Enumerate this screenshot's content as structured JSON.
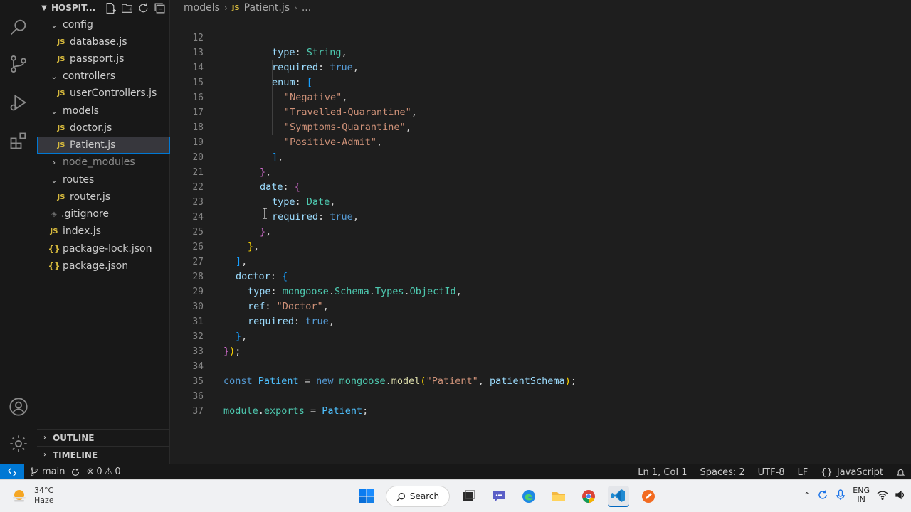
{
  "explorer": {
    "title": "HOSPIT...",
    "items": [
      {
        "label": "config",
        "type": "folder",
        "open": true
      },
      {
        "label": "database.js",
        "type": "js"
      },
      {
        "label": "passport.js",
        "type": "js"
      },
      {
        "label": "controllers",
        "type": "folder",
        "open": true
      },
      {
        "label": "userControllers.js",
        "type": "js"
      },
      {
        "label": "models",
        "type": "folder",
        "open": true
      },
      {
        "label": "doctor.js",
        "type": "js"
      },
      {
        "label": "Patient.js",
        "type": "js",
        "selected": true
      },
      {
        "label": "node_modules",
        "type": "folder",
        "open": false
      },
      {
        "label": "routes",
        "type": "folder",
        "open": true
      },
      {
        "label": "router.js",
        "type": "js"
      },
      {
        "label": ".gitignore",
        "type": "git"
      },
      {
        "label": "index.js",
        "type": "js"
      },
      {
        "label": "package-lock.json",
        "type": "json"
      },
      {
        "label": "package.json",
        "type": "json"
      }
    ],
    "outline_label": "OUTLINE",
    "timeline_label": "TIMELINE"
  },
  "breadcrumb": {
    "folder": "models",
    "file": "Patient.js",
    "more": "..."
  },
  "icons": {
    "file_js": "JS",
    "file_json": "{}",
    "file_git": "◈"
  },
  "editor": {
    "line_numbers": [
      "12",
      "13",
      "14",
      "15",
      "16",
      "17",
      "18",
      "19",
      "20",
      "21",
      "22",
      "23",
      "24",
      "25",
      "26",
      "27",
      "28",
      "29",
      "30",
      "31",
      "32",
      "33",
      "34",
      "35",
      "36",
      "37"
    ],
    "lines": {
      "l12": {
        "k": "type",
        "p": ": ",
        "v": "String",
        "e": ","
      },
      "l13": {
        "k": "required",
        "p": ": ",
        "v": "true",
        "e": ","
      },
      "l14": {
        "k": "enum",
        "p": ": ",
        "b": "["
      },
      "l15": {
        "s": "\"Negative\"",
        "e": ","
      },
      "l16": {
        "s": "\"Travelled-Quarantine\"",
        "e": ","
      },
      "l17": {
        "s": "\"Symptoms-Quarantine\"",
        "e": ","
      },
      "l18": {
        "s": "\"Positive-Admit\"",
        "e": ","
      },
      "l19": {
        "b": "]",
        "e": ","
      },
      "l20": {
        "b": "}",
        "e": ","
      },
      "l21": {
        "k": "date",
        "p": ": ",
        "b": "{"
      },
      "l22": {
        "k": "type",
        "p": ": ",
        "v": "Date",
        "e": ","
      },
      "l23": {
        "k": "required",
        "p": ": ",
        "v": "true",
        "e": ","
      },
      "l24": {
        "b": "}",
        "e": ","
      },
      "l25": {
        "b": "}",
        "e": ","
      },
      "l26": {
        "b": "]",
        "e": ","
      },
      "l27": {
        "k": "doctor",
        "p": ": ",
        "b": "{"
      },
      "l28": {
        "k": "type",
        "p": ": ",
        "o": "mongoose",
        "d1": ".",
        "o2": "Schema",
        "d2": ".",
        "o3": "Types",
        "d3": ".",
        "o4": "ObjectId",
        "e": ","
      },
      "l29": {
        "k": "ref",
        "p": ": ",
        "s": "\"Doctor\"",
        "e": ","
      },
      "l30": {
        "k": "required",
        "p": ": ",
        "v": "true",
        "e": ","
      },
      "l31": {
        "b": "}",
        "e": ","
      },
      "l32": {
        "b": "}",
        "b2": ")",
        "e": ";"
      },
      "l34": {
        "kw": "const",
        "sp": " ",
        "var": "Patient",
        "eq": " = ",
        "kw2": "new",
        "sp2": " ",
        "obj": "mongoose",
        "dot": ".",
        "fn": "model",
        "po": "(",
        "s": "\"Patient\"",
        "cm": ", ",
        "arg": "patientSchema",
        "pc": ")",
        "e": ";"
      },
      "l36": {
        "obj": "module",
        "dot": ".",
        "prop": "exports",
        "eq": " = ",
        "var": "Patient",
        "e": ";"
      }
    }
  },
  "statusbar": {
    "branch": "main",
    "errors": "0",
    "warnings": "0",
    "position": "Ln 1, Col 1",
    "spaces": "Spaces: 2",
    "encoding": "UTF-8",
    "eol": "LF",
    "lang_braces": "{}",
    "language": "JavaScript"
  },
  "taskbar": {
    "temp": "34°C",
    "condition": "Haze",
    "search_label": "Search",
    "lang_line1": "ENG",
    "lang_line2": "IN"
  },
  "colors": {
    "accent": "#0078d4",
    "js_icon": "#d7ba3d"
  }
}
